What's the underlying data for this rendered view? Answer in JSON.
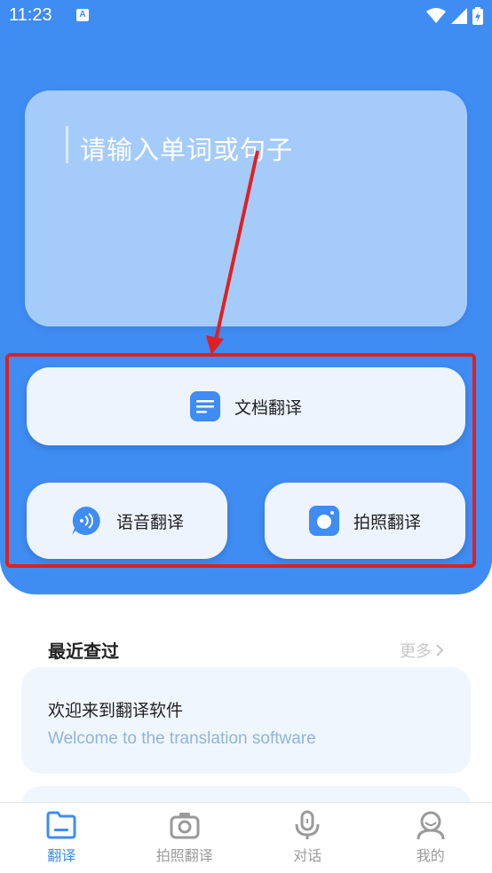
{
  "status_bar": {
    "time": "11:23",
    "notification_badge": "A"
  },
  "input": {
    "placeholder": "请输入单词或句子"
  },
  "actions": {
    "document": {
      "label": "文档翻译",
      "icon": "document-icon"
    },
    "voice": {
      "label": "语音翻译",
      "icon": "voice-icon"
    },
    "photo": {
      "label": "拍照翻译",
      "icon": "camera-icon"
    }
  },
  "recent": {
    "title": "最近查过",
    "more_label": "更多",
    "items": [
      {
        "source": "欢迎来到翻译软件",
        "translation": "Welcome to the translation software"
      }
    ]
  },
  "tabbar": {
    "tabs": [
      {
        "label": "翻译",
        "icon": "translate-icon",
        "active": true
      },
      {
        "label": "拍照翻译",
        "icon": "camera-icon",
        "active": false
      },
      {
        "label": "对话",
        "icon": "microphone-icon",
        "active": false
      },
      {
        "label": "我的",
        "icon": "profile-icon",
        "active": false
      }
    ]
  },
  "colors": {
    "primary": "#3f8cf3",
    "annotation": "#e02020"
  }
}
